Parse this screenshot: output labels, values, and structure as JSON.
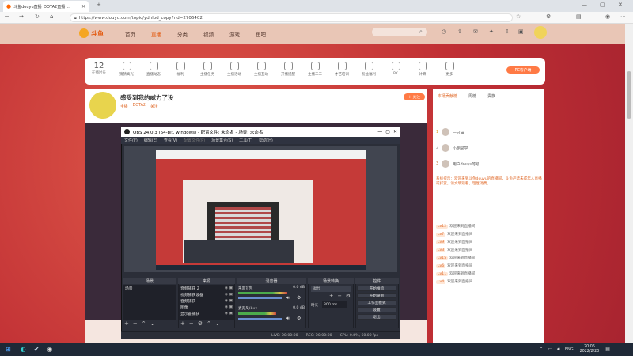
{
  "browser": {
    "tab_title": "斗鱼douyu直播_DOTA2直播_...",
    "url": "https://www.douyu.com/topic/ydhlpd_copy?rid=2706402"
  },
  "site": {
    "logo": "斗鱼",
    "nav": [
      "首页",
      "直播",
      "分类",
      "视频",
      "游戏",
      "鱼吧"
    ]
  },
  "features": {
    "count_value": "12",
    "count_label": "在播时长",
    "items": [
      "猜猜高光",
      "直播动态",
      "福利",
      "主播任务",
      "主播活动",
      "主播互动",
      "开播提醒",
      "主播二三",
      "才艺培训",
      "粉丝福利",
      "PK",
      "计算",
      "更多"
    ],
    "pc_button": "PC客户端"
  },
  "room": {
    "title": "感受到我的威力了没",
    "tags": [
      "主播",
      "DOTA2",
      "关注"
    ],
    "follow_label": "+ 关注"
  },
  "obs": {
    "title": "OBS 24.0.3 (64-bit, windows) - 配置文件: 未命名 - 场景: 未命名",
    "menu": [
      "文件(F)",
      "编辑(E)",
      "查看(V)",
      "配置文件(P)",
      "场景集合(S)",
      "工具(T)",
      "帮助(H)"
    ],
    "docks": {
      "scenes": "场景",
      "sources": "来源",
      "mixer": "混音器",
      "transitions": "场景转换",
      "controls": "控件"
    },
    "scene_items": [
      "场景"
    ],
    "source_items": [
      "音频捕获 2",
      "视频捕获设备",
      "音频捕获",
      "图像",
      "显示器捕获"
    ],
    "mixer_items": [
      {
        "name": "桌面音频",
        "db": "0.0 dB"
      },
      {
        "name": "麦克风/Aux",
        "db": "0.0 dB"
      }
    ],
    "transition": {
      "type": "淡出",
      "duration_label": "时长",
      "duration_value": "300 ms"
    },
    "controls": [
      "开始推流",
      "开始录制",
      "工作室模式",
      "设置",
      "退出"
    ],
    "status": [
      "LIVE: 00:00:00",
      "REC: 00:00:00",
      "CPU: 0.8%, 60.00 fps"
    ]
  },
  "chat": {
    "tabs": [
      "本场贡献榜",
      "周榜",
      "贵族"
    ],
    "ranks": [
      "1",
      "2",
      "3"
    ],
    "rank_users": [
      "一只猫",
      "小明同学",
      "用户douyu等级"
    ],
    "notice": "系统提示：欢迎来到斗鱼douyu的直播间，斗鱼严禁未成年人直播或打赏。请文明观看，理性消费。",
    "lines": [
      {
        "badge": "Lv12",
        "text": "欢迎来到直播间"
      },
      {
        "badge": "Lv7",
        "text": "欢迎来到直播间"
      },
      {
        "badge": "Lv9",
        "text": "欢迎来到直播间"
      },
      {
        "badge": "Lv3",
        "text": "欢迎来到直播间"
      },
      {
        "badge": "Lv15",
        "text": "欢迎来到直播间"
      },
      {
        "badge": "Lv6",
        "text": "欢迎来到直播间"
      },
      {
        "badge": "Lv11",
        "text": "欢迎来到直播间"
      },
      {
        "badge": "Lv4",
        "text": "欢迎来到直播间"
      }
    ]
  },
  "taskbar": {
    "lang": "ENG",
    "time": "20:06",
    "date": "2022/2/23"
  }
}
